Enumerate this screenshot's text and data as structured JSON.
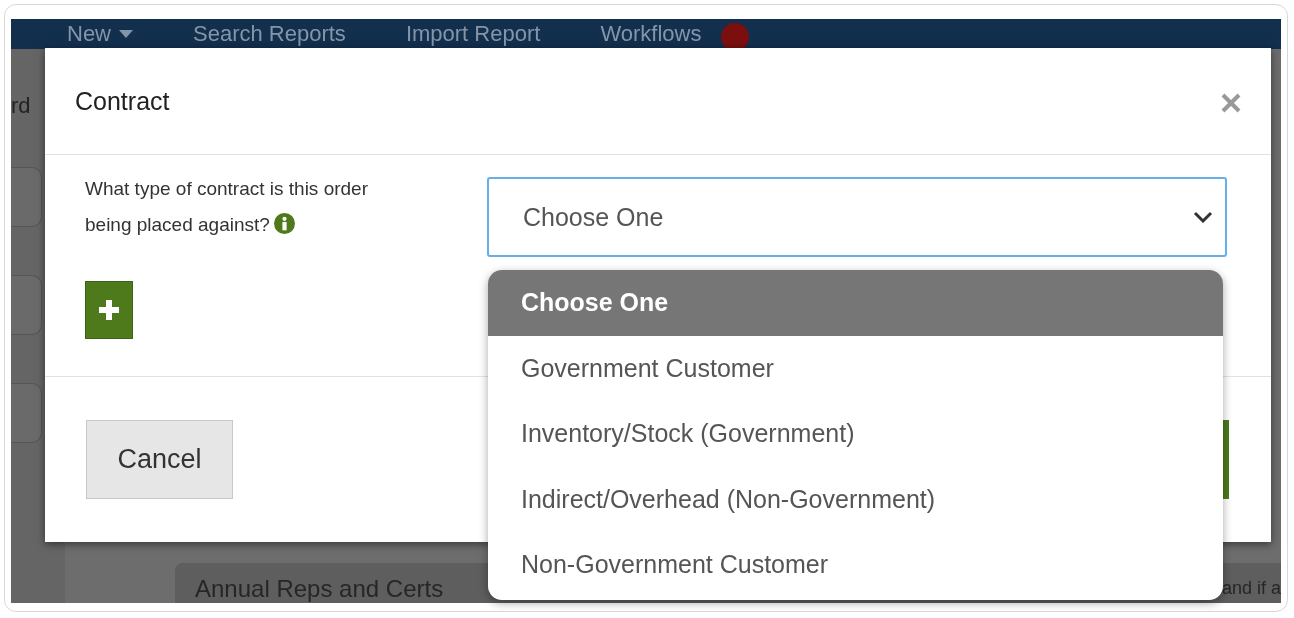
{
  "nav": {
    "items": [
      {
        "label": "New",
        "has_menu": true
      },
      {
        "label": "Search Reports",
        "has_menu": false
      },
      {
        "label": "Import Report",
        "has_menu": false
      },
      {
        "label": "Workflows",
        "has_menu": false
      }
    ]
  },
  "background": {
    "left_text": "rd",
    "card_title": "Annual Reps and Certs",
    "card_text": "and if a"
  },
  "modal": {
    "title": "Contract",
    "question": "What type of contract is this order being placed against?",
    "select": {
      "value": "Choose One",
      "expanded": true
    },
    "options": [
      {
        "label": "Choose One",
        "selected": true
      },
      {
        "label": "Government Customer",
        "selected": false
      },
      {
        "label": "Inventory/Stock (Government)",
        "selected": false
      },
      {
        "label": "Indirect/Overhead (Non-Government)",
        "selected": false
      },
      {
        "label": "Non-Government Customer",
        "selected": false
      }
    ],
    "cancel": "Cancel"
  }
}
